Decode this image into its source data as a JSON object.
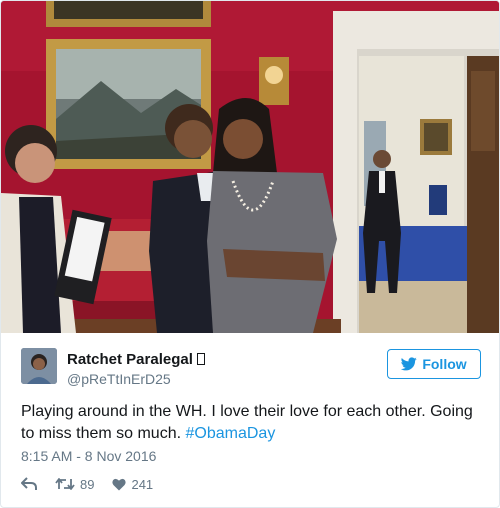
{
  "tweet": {
    "display_name": "Ratchet Paralegal",
    "handle": "@pReTtInErD25",
    "follow_label": "Follow",
    "text_before": "Playing around in the WH. I love their love for each other. Going to miss them so much. ",
    "hashtag": "#ObamaDay",
    "timestamp": "8:15 AM - 8 Nov 2016",
    "retweets": "89",
    "likes": "241"
  },
  "colors": {
    "accent": "#1b95e0",
    "muted": "#657786",
    "wall_red": "#b01a36"
  },
  "icons": [
    "bird-icon",
    "reply-icon",
    "retweet-icon",
    "heart-icon"
  ]
}
